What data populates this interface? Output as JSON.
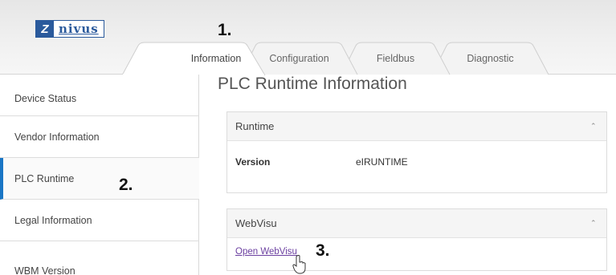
{
  "brand": {
    "logo_text": "nivus"
  },
  "tabs": [
    {
      "label": "Information",
      "active": true
    },
    {
      "label": "Configuration",
      "active": false
    },
    {
      "label": "Fieldbus",
      "active": false
    },
    {
      "label": "Diagnostic",
      "active": false
    }
  ],
  "sidebar": {
    "items": [
      {
        "label": "Device Status",
        "active": false
      },
      {
        "label": "Vendor Information",
        "active": false
      },
      {
        "label": "PLC Runtime",
        "active": true
      },
      {
        "label": "Legal Information",
        "active": false
      },
      {
        "label": "WBM Version",
        "active": false
      }
    ]
  },
  "main": {
    "title": "PLC Runtime Information",
    "runtime_panel": {
      "title": "Runtime",
      "rows": [
        {
          "label": "Version",
          "value": "eIRUNTIME"
        }
      ]
    },
    "webvisu_panel": {
      "title": "WebVisu",
      "link": "Open WebVisu"
    }
  },
  "annotations": {
    "step1": "1.",
    "step2": "2.",
    "step3": "3."
  },
  "colors": {
    "accent": "#1976c5",
    "logo": "#2a5a9c",
    "link": "#6b3fa0"
  }
}
